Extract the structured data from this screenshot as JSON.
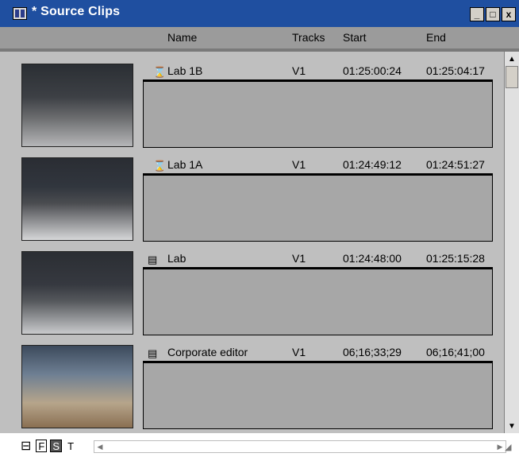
{
  "window": {
    "title": "* Source Clips",
    "controls": {
      "minimize": "_",
      "maximize": "□",
      "close": "x"
    }
  },
  "columns": {
    "name": "Name",
    "tracks": "Tracks",
    "start": "Start",
    "end": "End"
  },
  "clips": [
    {
      "name": "Lab 1B",
      "tracks": "V1",
      "start": "01:25:00:24",
      "end": "01:25:04:17",
      "icon": "subclip-icon"
    },
    {
      "name": "Lab 1A",
      "tracks": "V1",
      "start": "01:24:49:12",
      "end": "01:24:51:27",
      "icon": "subclip-icon"
    },
    {
      "name": "Lab",
      "tracks": "V1",
      "start": "01:24:48:00",
      "end": "01:25:15:28",
      "icon": "masterclip-icon"
    },
    {
      "name": "Corporate editor",
      "tracks": "V1",
      "start": "06;16;33;29",
      "end": "06;16;41;00",
      "icon": "masterclip-icon"
    }
  ],
  "bottom_bar": {
    "frame_view": "F",
    "script_view": "S",
    "text_view": "T"
  },
  "colors": {
    "titlebar": "#1f4fa0",
    "header": "#9b9b9b",
    "panel": "#bfbfbf",
    "clip_box": "#a7a7a7"
  }
}
